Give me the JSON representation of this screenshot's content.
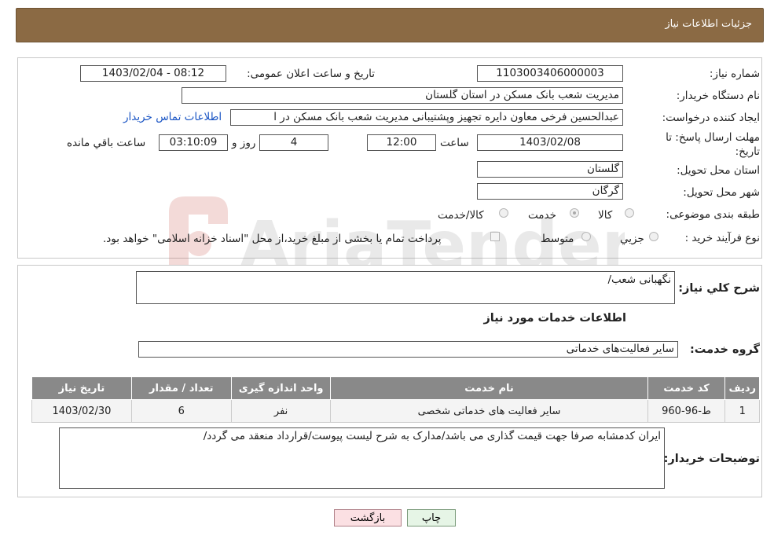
{
  "header": {
    "title": "جزئیات اطلاعات نیاز"
  },
  "form": {
    "need_number": {
      "label": "شماره نیاز:",
      "value": "1103003406000003"
    },
    "announce_datetime": {
      "label": "تاریخ و ساعت اعلان عمومی:",
      "value": "1403/02/04 - 08:12"
    },
    "buyer_org": {
      "label": "نام دستگاه خریدار:",
      "value": "مدیریت شعب بانک مسکن در استان گلستان"
    },
    "requester": {
      "label": "ایجاد کننده درخواست:",
      "value": "عبدالحسین فرخی معاون دایره تجهیز وپشتیبانی مدیریت شعب بانک مسکن در ا"
    },
    "buyer_contact_link": "اطلاعات تماس خریدار",
    "deadline": {
      "label": "مهلت ارسال پاسخ: تا تاریخ:",
      "date": "1403/02/08",
      "time_label": "ساعت",
      "time": "12:00",
      "days": "4",
      "days_label": "روز و",
      "remaining": "03:10:09",
      "remaining_label": "ساعت باقي مانده"
    },
    "delivery_province": {
      "label": "استان محل تحویل:",
      "value": "گلستان"
    },
    "delivery_city": {
      "label": "شهر محل تحویل:",
      "value": "گرگان"
    },
    "category": {
      "label": "طبقه بندی موضوعی:",
      "options": [
        {
          "label": "کالا",
          "checked": false
        },
        {
          "label": "خدمت",
          "checked": true
        },
        {
          "label": "کالا/خدمت",
          "checked": false
        }
      ]
    },
    "purchase_process": {
      "label": "نوع فرآیند خرید :",
      "options": [
        {
          "label": "جزیي",
          "checked": false
        },
        {
          "label": "متوسط",
          "checked": false
        }
      ],
      "note": "پرداخت تمام یا بخشی از مبلغ خرید،از محل \"اسناد خزانه اسلامی\" خواهد بود."
    }
  },
  "details": {
    "general_description": {
      "label": "شرح کلي نیاز:",
      "value": "نگهبانی شعب/"
    },
    "services_section_title": "اطلاعات خدمات مورد نیاز",
    "service_group": {
      "label": "گروه خدمت:",
      "value": "سایر فعالیت‌های خدماتی"
    },
    "table": {
      "headers": [
        "ردیف",
        "کد خدمت",
        "نام خدمت",
        "واحد اندازه گیری",
        "تعداد / مقدار",
        "تاریخ نیاز"
      ],
      "rows": [
        [
          "1",
          "ط-96-960",
          "سایر فعالیت های خدماتی شخصی",
          "نفر",
          "6",
          "1403/02/30"
        ]
      ]
    },
    "buyer_notes": {
      "label": "توضیحات خریدار:",
      "value": "ایران کدمشابه صرفا جهت قیمت گذاری می باشد/مدارک به شرح لیست پیوست/قرارداد منعقد می گردد/"
    }
  },
  "buttons": {
    "print": "چاپ",
    "back": "بازگشت"
  },
  "watermark": "AriaTender.neT"
}
